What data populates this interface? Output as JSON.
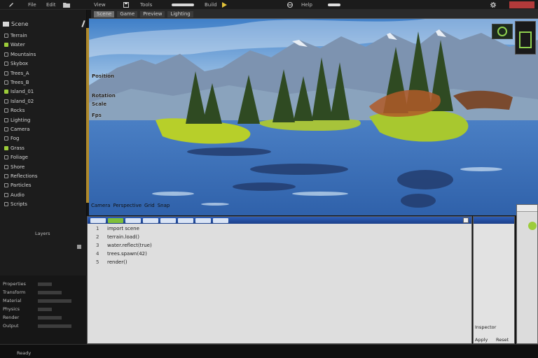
{
  "topbar": {
    "menus": [
      "File",
      "Edit",
      "View",
      "Tools",
      "Build",
      "Help"
    ],
    "icons": [
      "pencil-icon",
      "folder-icon",
      "save-icon",
      "play-icon",
      "globe-icon",
      "gear-icon"
    ]
  },
  "left_panel": {
    "header": "Scene",
    "tree": [
      {
        "label": "Terrain",
        "green": false
      },
      {
        "label": "Water",
        "green": true
      },
      {
        "label": "Mountains",
        "green": false
      },
      {
        "label": "Skybox",
        "green": false
      },
      {
        "label": "Trees_A",
        "green": false
      },
      {
        "label": "Trees_B",
        "green": false
      },
      {
        "label": "Island_01",
        "green": true
      },
      {
        "label": "Island_02",
        "green": false
      },
      {
        "label": "Rocks",
        "green": false
      },
      {
        "label": "Lighting",
        "green": false
      },
      {
        "label": "Camera",
        "green": false
      },
      {
        "label": "Fog",
        "green": false
      },
      {
        "label": "Grass",
        "green": true
      },
      {
        "label": "Foliage",
        "green": false
      },
      {
        "label": "Shore",
        "green": false
      },
      {
        "label": "Reflections",
        "green": false
      },
      {
        "label": "Particles",
        "green": false
      },
      {
        "label": "Audio",
        "green": false
      },
      {
        "label": "Scripts",
        "green": false
      }
    ],
    "group_label": "Layers",
    "bottom_rows": [
      "Properties",
      "Transform",
      "Material",
      "Physics",
      "Render",
      "Output"
    ]
  },
  "viewport": {
    "tabs": [
      "Scene",
      "Game",
      "Preview",
      "Lighting"
    ],
    "overlay_lines": [
      "Position",
      "Rotation",
      "Scale",
      "Fps"
    ],
    "footer": [
      "Camera",
      "Perspective",
      "Grid",
      "Snap"
    ]
  },
  "lower_editor": {
    "rows": [
      {
        "ln": "1",
        "text": "import scene"
      },
      {
        "ln": "2",
        "text": "terrain.load()"
      },
      {
        "ln": "3",
        "text": "water.reflect(true)"
      },
      {
        "ln": "4",
        "text": "trees.spawn(42)"
      },
      {
        "ln": "5",
        "text": "render()"
      }
    ]
  },
  "right_panel": {
    "footer": "Inspector",
    "labels": [
      "Apply",
      "Reset"
    ]
  },
  "status": {
    "text": "Ready"
  },
  "colors": {
    "accent_blue": "#2f5fb8",
    "accent_green": "#9ccc3a",
    "scroll_gold": "#b08a2b"
  }
}
